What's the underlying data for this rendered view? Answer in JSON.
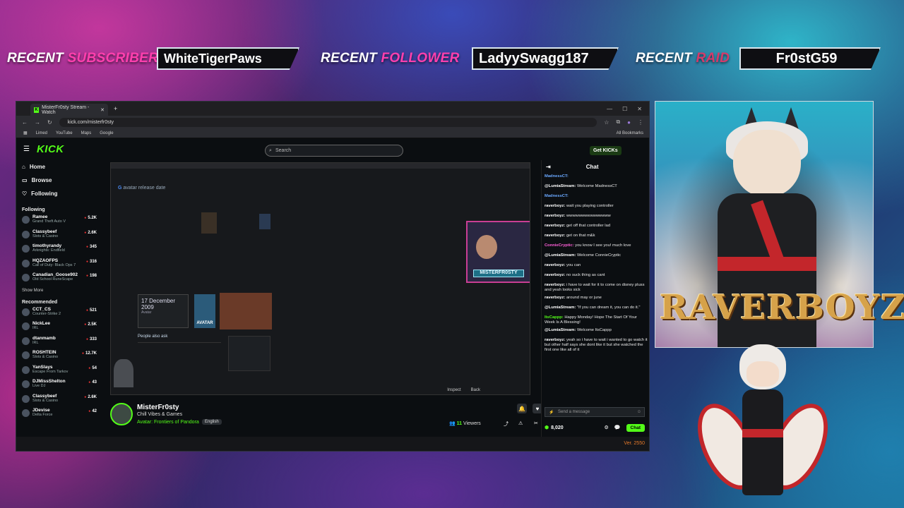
{
  "overlay": {
    "recent_subscriber": {
      "label_white": "RECENT",
      "label_pink": "SUBSCRIBER",
      "value": "WhiteTigerPaws"
    },
    "recent_follower": {
      "label_white": "RECENT",
      "label_pink": "FOLLOWER",
      "value": "LadyySwagg187"
    },
    "recent_raid": {
      "label_white": "RECENT",
      "label_pink": "RAID",
      "value": "Fr0stG59"
    },
    "brand": "RAVERBOYZ",
    "version": "Ver. 2550"
  },
  "browser": {
    "tab_title": "MisterFr0sty Stream - Watch",
    "url": "kick.com/misterfr0sty",
    "bookmarks": [
      "Limed",
      "YouTube",
      "Maps",
      "Google"
    ],
    "all_bookmarks": "All Bookmarks"
  },
  "kick": {
    "logo": "KICK",
    "search_placeholder": "Search",
    "get_kicks": "Get KICKs",
    "nav": [
      "Home",
      "Browse",
      "Following"
    ],
    "following_label": "Following",
    "following": [
      {
        "name": "Ramee",
        "game": "Grand Theft Auto V",
        "count": "5.2K"
      },
      {
        "name": "Classybeef",
        "game": "Slots & Casino",
        "count": "2.6K"
      },
      {
        "name": "timothyrandy",
        "game": "Arknights: Endfield",
        "count": "345"
      },
      {
        "name": "HQZAOFPS",
        "game": "Call of Duty: Black Ops 7",
        "count": "316"
      },
      {
        "name": "Canadian_Goose902",
        "game": "Old School RuneScape",
        "count": "198"
      }
    ],
    "show_more": "Show More",
    "recommended_label": "Recommended",
    "recommended": [
      {
        "name": "CCT_CS",
        "game": "Counter-Strike 2",
        "count": "521"
      },
      {
        "name": "NickLee",
        "game": "IRL",
        "count": "2.5K"
      },
      {
        "name": "dtanmamb",
        "game": "IRL",
        "count": "333"
      },
      {
        "name": "ROSHTEIN",
        "game": "Slots & Casino",
        "count": "12.7K"
      },
      {
        "name": "YanSlays",
        "game": "Escape From Tarkov",
        "count": "54"
      },
      {
        "name": "DJMissShelton",
        "game": "Live DJ",
        "count": "43"
      },
      {
        "name": "Classybeef",
        "game": "Slots & Casino",
        "count": "2.6K"
      },
      {
        "name": "JDevise",
        "game": "Delta Force",
        "count": "42"
      }
    ],
    "player": {
      "google_query": "avatar release date",
      "date_card": "17 December 2009",
      "date_card_sub": "Avatar",
      "date_card_logo": "AVATAR",
      "people_also_ask": "People also ask",
      "cam_name": "MISTERFR0STY",
      "inspect": "Inspect",
      "back": "Back"
    },
    "streamer": {
      "name": "MisterFr0sty",
      "title": "Chill Vibes & Games",
      "category": "Avatar: Frontiers of Pandora",
      "language": "English",
      "viewers_count": "11",
      "viewers_label": "Viewers"
    },
    "chat": {
      "title": "Chat",
      "input_placeholder": "Send a message",
      "points": "8,020",
      "chat_button": "Chat",
      "messages": [
        {
          "user": "MadnessCT:",
          "text": "",
          "color": "#6aa8ff"
        },
        {
          "user": "@LumiaStream:",
          "text": "Welcome MadnessCT",
          "color": "#ffffff"
        },
        {
          "user": "MadnessCT:",
          "text": "",
          "color": "#6aa8ff"
        },
        {
          "user": "raverboyz:",
          "text": "wait you playing controller",
          "color": "#ffffff"
        },
        {
          "user": "raverboyz:",
          "text": "wwwwwwwwwwwwwww",
          "color": "#ffffff"
        },
        {
          "user": "raverboyz:",
          "text": "get off that controller lad",
          "color": "#ffffff"
        },
        {
          "user": "raverboyz:",
          "text": "get on that m&k",
          "color": "#ffffff"
        },
        {
          "user": "ConnieCryptic:",
          "text": "you know I see you! much love",
          "color": "#ff5fd8"
        },
        {
          "user": "@LumiaStream:",
          "text": "Welcome ConnieCryptic",
          "color": "#ffffff"
        },
        {
          "user": "raverboyz:",
          "text": "you can",
          "color": "#ffffff"
        },
        {
          "user": "raverboyz:",
          "text": "no suck thing as cant",
          "color": "#ffffff"
        },
        {
          "user": "raverboyz:",
          "text": "i have to wait for it to come on disney pluss and yeah looks sick",
          "color": "#ffffff"
        },
        {
          "user": "raverboyz:",
          "text": "around may or june",
          "color": "#ffffff"
        },
        {
          "user": "@LumiaStream:",
          "text": "\"If you can dream it, you can do it.\"",
          "color": "#ffffff"
        },
        {
          "user": "ItsCappp:",
          "text": "Happy Monday! Hope The Start Of Your Week Is A Blessing!",
          "color": "#53fc18"
        },
        {
          "user": "@LumiaStream:",
          "text": "Welcome ItsCappp",
          "color": "#ffffff"
        },
        {
          "user": "raverboyz:",
          "text": "yeah so i have to wait i wanted to go watch it but other half says she dont like it but she watched the first one like all of it",
          "color": "#ffffff"
        }
      ]
    }
  }
}
